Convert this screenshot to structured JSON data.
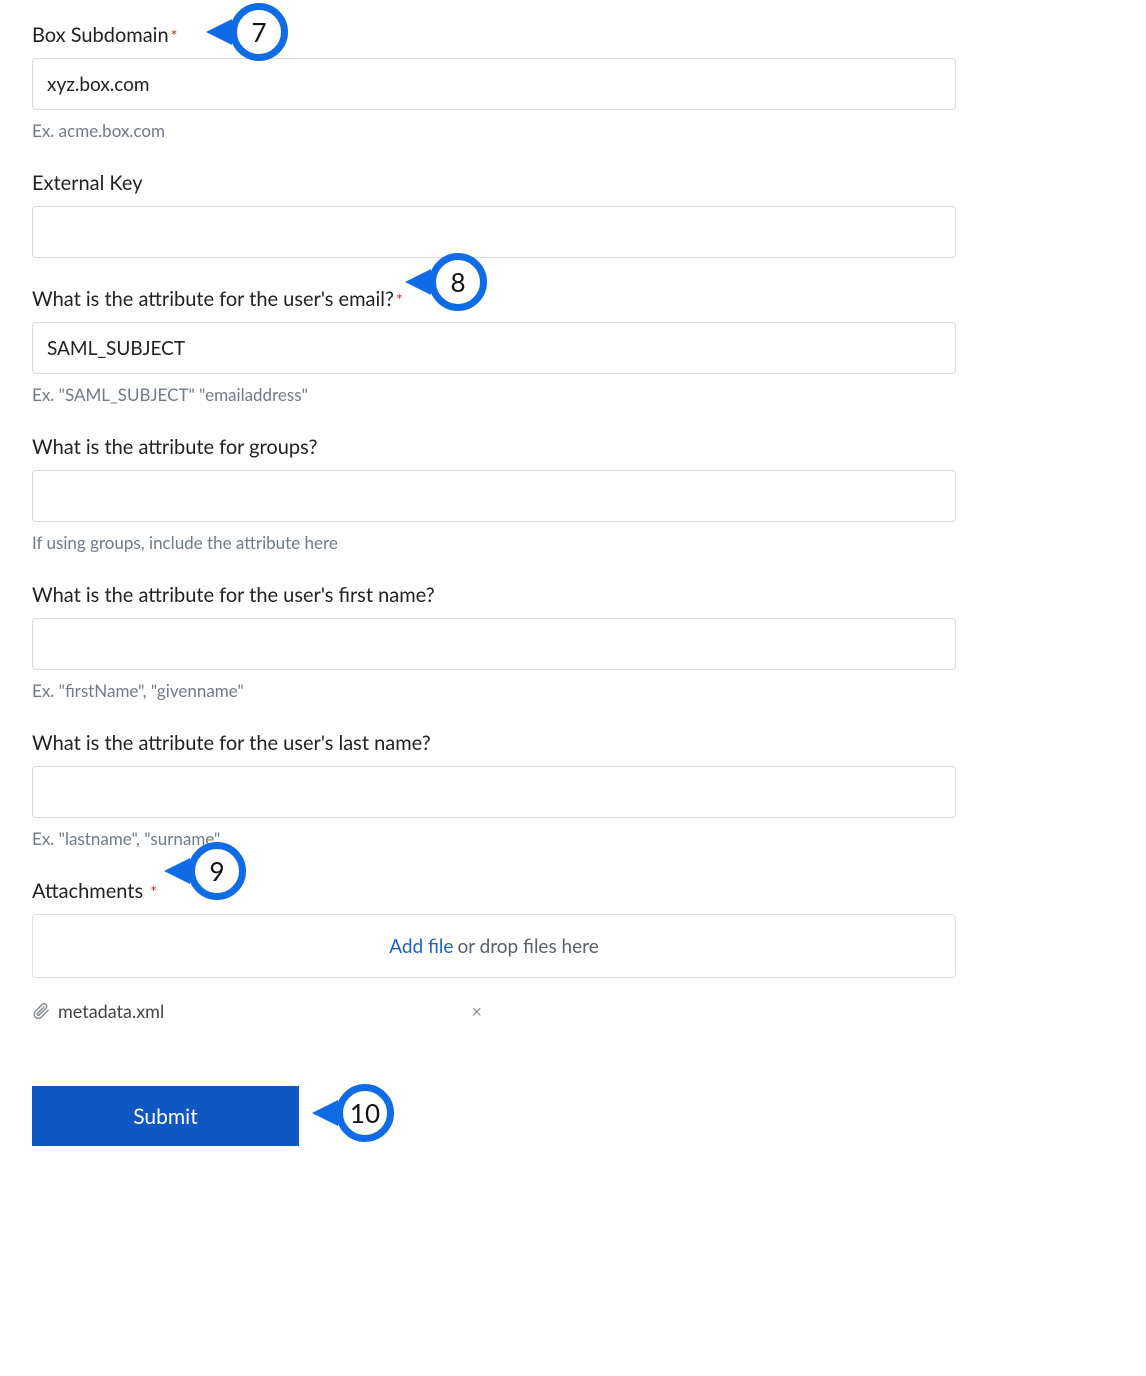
{
  "fields": {
    "subdomain": {
      "label": "Box Subdomain",
      "value": "xyz.box.com",
      "hint": "Ex. acme.box.com",
      "required": "*"
    },
    "external_key": {
      "label": "External Key",
      "value": ""
    },
    "email_attr": {
      "label": "What is the attribute for the user's email?",
      "value": "SAML_SUBJECT",
      "hint": "Ex. \"SAML_SUBJECT\" \"emailaddress\"",
      "required": "*"
    },
    "groups_attr": {
      "label": "What is the attribute for groups?",
      "value": "",
      "hint": "If using groups, include the attribute here"
    },
    "firstname_attr": {
      "label": "What is the attribute for the user's first name?",
      "value": "",
      "hint": "Ex. \"firstName\", \"givenname\""
    },
    "lastname_attr": {
      "label": "What is the attribute for the user's last name?",
      "value": "",
      "hint": "Ex. \"lastname\", \"surname\""
    },
    "attachments": {
      "label": "Attachments",
      "required": "*",
      "add_link": "Add file",
      "drop_text": "or drop files here",
      "file_name": "metadata.xml",
      "remove_glyph": "×"
    }
  },
  "submit_label": "Submit",
  "callouts": {
    "c7": "7",
    "c8": "8",
    "c9": "9",
    "c10": "10"
  }
}
